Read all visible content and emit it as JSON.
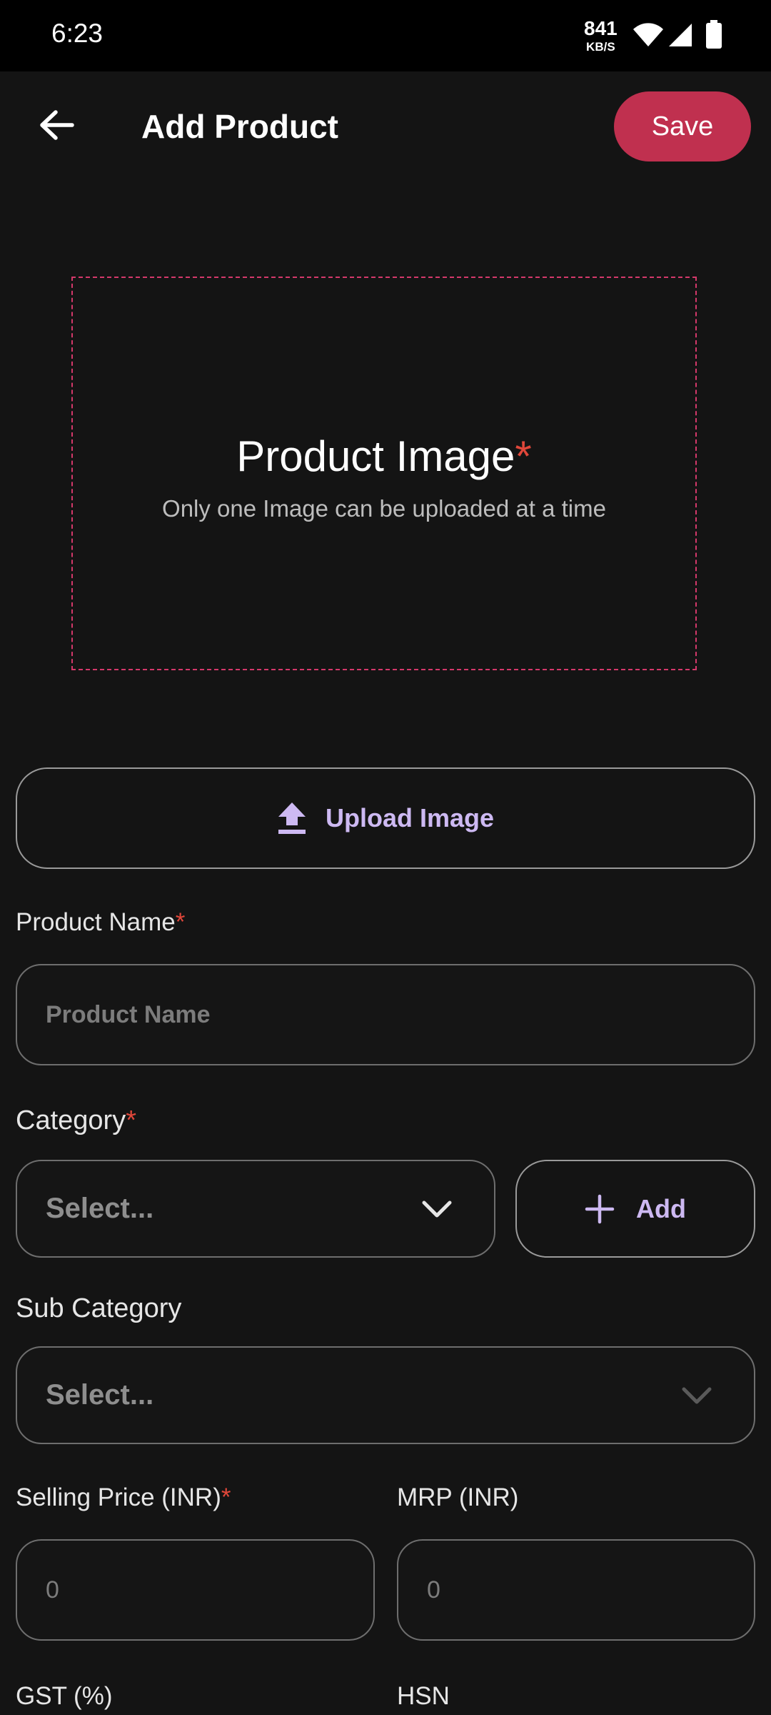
{
  "status_bar": {
    "time": "6:23",
    "net_speed": "841",
    "net_unit": "KB/S",
    "icons": [
      "wifi-icon",
      "signal-icon",
      "battery-icon"
    ]
  },
  "app_bar": {
    "title": "Add Product",
    "back_icon": "arrow-left-icon",
    "save_label": "Save"
  },
  "image_section": {
    "title": "Product Image",
    "required_mark": "*",
    "subtitle": "Only one Image can be uploaded at a time"
  },
  "upload": {
    "icon": "upload-icon",
    "label": "Upload Image"
  },
  "form": {
    "product_name": {
      "label": "Product Name",
      "required_mark": "*",
      "placeholder": "Product Name",
      "value": ""
    },
    "category": {
      "label": "Category",
      "required_mark": "*",
      "selected": "Select...",
      "add_label": "Add"
    },
    "sub_category": {
      "label": "Sub Category",
      "selected": "Select..."
    },
    "selling_price": {
      "label": "Selling Price (INR)",
      "required_mark": "*",
      "placeholder": "0"
    },
    "mrp": {
      "label": "MRP (INR)",
      "placeholder": "0"
    },
    "gst": {
      "label": "GST (%)"
    },
    "hsn": {
      "label": "HSN"
    }
  },
  "colors": {
    "background": "#141414",
    "accent": "#c0304f",
    "required": "#e0473a",
    "link_text": "#cdb9f2",
    "dashed_border": "#d4386a"
  }
}
